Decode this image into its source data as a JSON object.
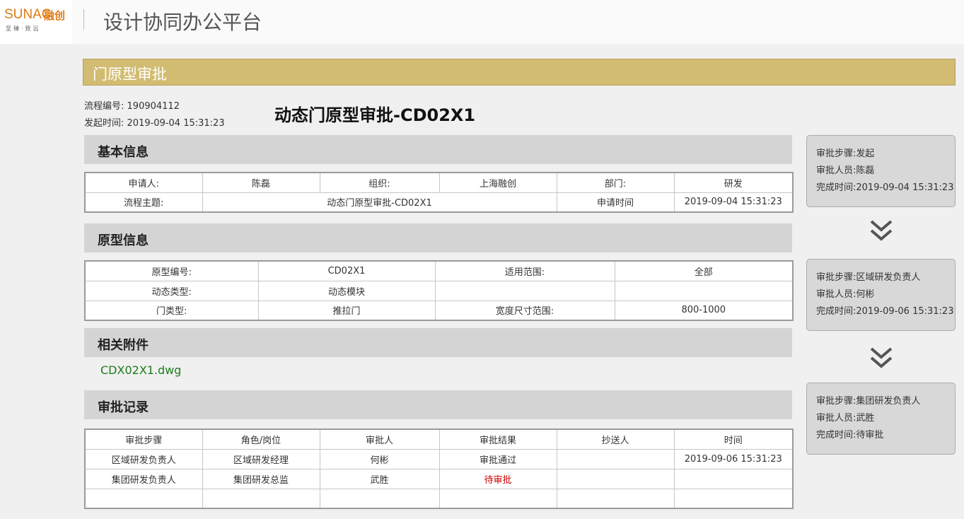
{
  "header": {
    "logo_en": "SUNAC",
    "logo_cn": "融创",
    "logo_sub": "至臻·致远",
    "app_title": "设计协同办公平台"
  },
  "page": {
    "section_title": "门原型审批",
    "flow_no_label": "流程编号:",
    "flow_no": "190904112",
    "start_time_label": "发起时间:",
    "start_time": "2019-09-04 15:31:23",
    "doc_title": "动态门原型审批-CD02X1"
  },
  "basic_info": {
    "title": "基本信息",
    "rows": [
      [
        "申请人:",
        "陈磊",
        "组织:",
        "上海融创",
        "部门:",
        "研发"
      ],
      [
        "流程主题:",
        "动态门原型审批-CD02X1",
        "申请时间",
        "2019-09-04 15:31:23"
      ]
    ]
  },
  "prototype_info": {
    "title": "原型信息",
    "rows": [
      [
        "原型编号:",
        "CD02X1",
        "适用范围:",
        "全部"
      ],
      [
        "动态类型:",
        "动态模块",
        "",
        ""
      ],
      [
        "门类型:",
        "推拉门",
        "宽度尺寸范围:",
        "800-1000"
      ]
    ]
  },
  "attachments": {
    "title": "相关附件",
    "files": [
      "CDX02X1.dwg"
    ]
  },
  "approval_records": {
    "title": "审批记录",
    "columns": [
      "审批步骤",
      "角色/岗位",
      "审批人",
      "审批结果",
      "抄送人",
      "时间"
    ],
    "rows": [
      [
        "区域研发负责人",
        "区域研发经理",
        "何彬",
        "审批通过",
        "",
        "2019-09-06 15:31:23"
      ],
      [
        "集团研发负责人",
        "集团研发总监",
        "武胜",
        "待审批",
        "",
        ""
      ],
      [
        "",
        "",
        "",
        "",
        "",
        ""
      ]
    ],
    "pending_color": "#cc0000"
  },
  "workflow": {
    "step_label": "审批步骤:",
    "person_label": "审批人员:",
    "time_label": "完成时间:",
    "steps": [
      {
        "step": "发起",
        "person": "陈磊",
        "time": "2019-09-04 15:31:23"
      },
      {
        "step": "区域研发负责人",
        "person": "何彬",
        "time": "2019-09-06 15:31:23"
      },
      {
        "step": "集团研发负责人",
        "person": "武胜",
        "time": "待审批"
      }
    ],
    "arrow_icon": "double-chevron-down-icon"
  },
  "colors": {
    "banner": "#d2bc72",
    "brand": "#e07a12",
    "attachment_link": "#1e7a1e"
  }
}
